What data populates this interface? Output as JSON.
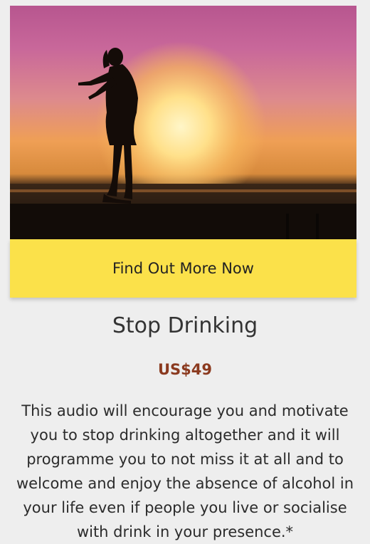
{
  "product": {
    "image_alt": "Woman silhouette at sunset by the sea",
    "cta_label": "Find Out More Now",
    "title": "Stop Drinking",
    "price": "US$49",
    "description": "This audio will encourage you and motivate you to stop drinking altogether and it will programme you to not miss it at all and to welcome and enjoy the absence of alcohol in your life even if people you live or socialise with drink in your presence.*"
  },
  "colors": {
    "cta_background": "#fbe14a",
    "price": "#8b3a1f",
    "page_background": "#eeeeee"
  }
}
